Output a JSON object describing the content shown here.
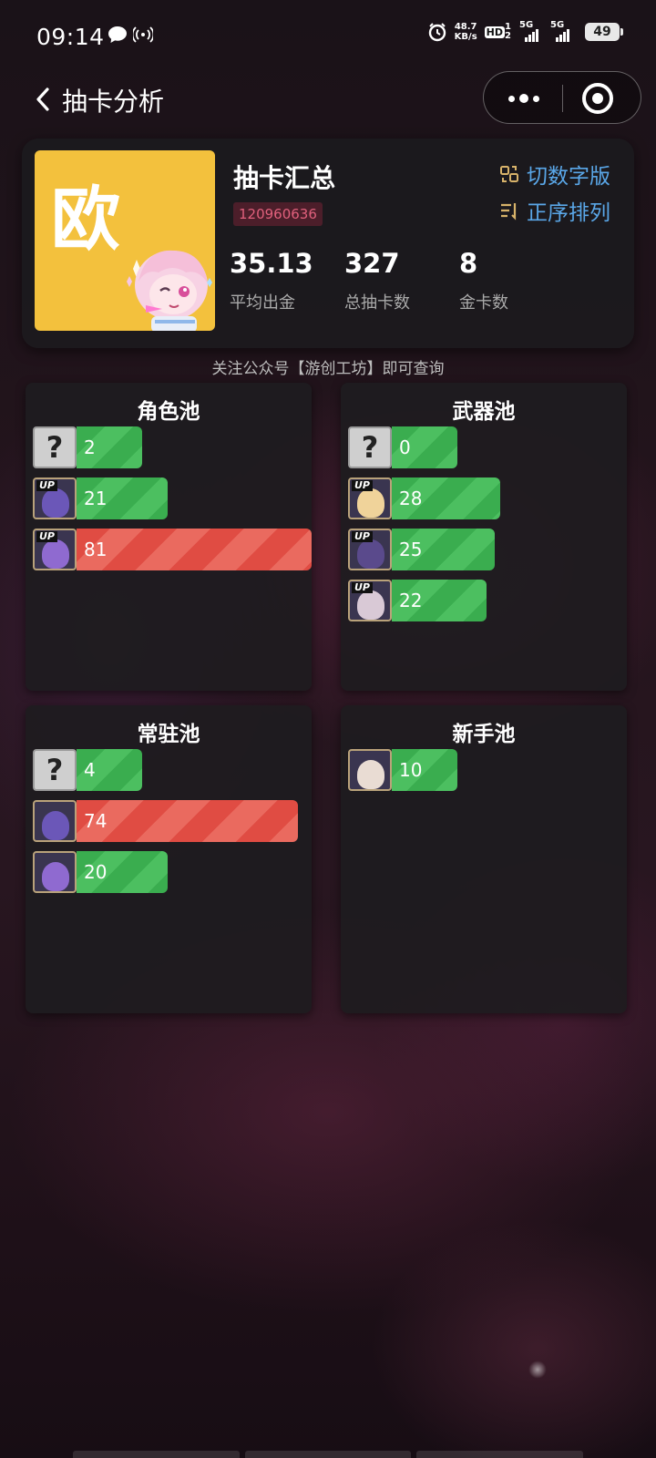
{
  "status_bar": {
    "time": "09:14",
    "net_speed_value": "48.7",
    "net_speed_unit": "KB/s",
    "hd_label": "HD",
    "sim_numbers": "12",
    "signal1_label": "5G",
    "signal2_label": "5G",
    "battery": "49"
  },
  "nav": {
    "title": "抽卡分析"
  },
  "summary": {
    "luck_char": "欧",
    "title": "抽卡汇总",
    "uid": "120960636",
    "switch_label": "切数字版",
    "sort_label": "正序排列",
    "stats": [
      {
        "value": "35.13",
        "label": "平均出金"
      },
      {
        "value": "327",
        "label": "总抽卡数"
      },
      {
        "value": "8",
        "label": "金卡数"
      }
    ]
  },
  "notice": "关注公众号【游创工坊】即可查询",
  "pools": [
    {
      "title": "角色池",
      "rows": [
        {
          "type": "unknown",
          "value": "2",
          "color": "green",
          "fill": 0.12
        },
        {
          "type": "up",
          "value": "21",
          "color": "green",
          "fill": 0.25
        },
        {
          "type": "up",
          "value": "81",
          "color": "red",
          "fill": 0.98
        }
      ]
    },
    {
      "title": "武器池",
      "rows": [
        {
          "type": "unknown",
          "value": "0",
          "color": "green",
          "fill": 0.12
        },
        {
          "type": "up",
          "value": "28",
          "color": "green",
          "fill": 0.34
        },
        {
          "type": "up",
          "value": "25",
          "color": "green",
          "fill": 0.31
        },
        {
          "type": "up",
          "value": "22",
          "color": "green",
          "fill": 0.27
        }
      ]
    },
    {
      "title": "常驻池",
      "rows": [
        {
          "type": "unknown",
          "value": "4",
          "color": "green",
          "fill": 0.12
        },
        {
          "type": "char",
          "value": "74",
          "color": "red",
          "fill": 0.91
        },
        {
          "type": "char",
          "value": "20",
          "color": "green",
          "fill": 0.25
        }
      ]
    },
    {
      "title": "新手池",
      "rows": [
        {
          "type": "char",
          "value": "10",
          "color": "green",
          "fill": 0.12
        }
      ]
    }
  ],
  "colors": {
    "accent_blue": "#5aa7e8",
    "luck_yellow": "#f3c13d",
    "bar_green": "#3aad4f",
    "bar_red": "#e04c43",
    "uid_pink": "#e0607c"
  },
  "icons": {
    "back": "chevron-left-icon",
    "more": "more-dots-icon",
    "close": "target-circle-icon",
    "switch": "switch-icon",
    "sort": "sort-icon"
  }
}
